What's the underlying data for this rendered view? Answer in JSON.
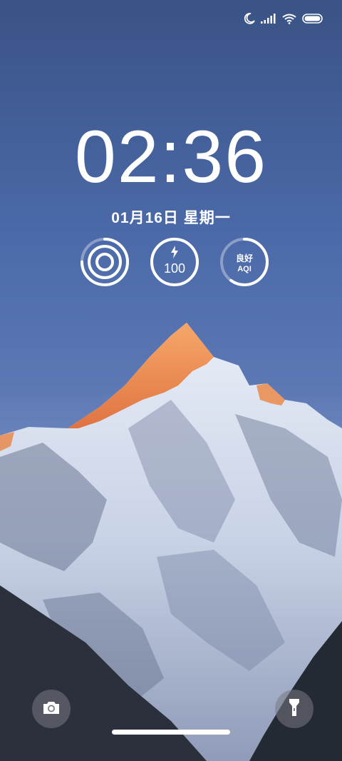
{
  "status_bar": {
    "icons": [
      "moon-icon",
      "signal-icon",
      "wifi-icon",
      "battery-icon"
    ]
  },
  "lockscreen": {
    "time": "02:36",
    "date": "01月16日 星期一"
  },
  "widgets": {
    "storage": {
      "icon": "storage-rings-icon",
      "fill_fraction": 0.75
    },
    "battery": {
      "icon": "bolt-icon",
      "value": "100",
      "fill_fraction": 1.0
    },
    "aqi": {
      "status": "良好",
      "label": "AQI",
      "fill_fraction": 0.6
    }
  },
  "shortcuts": {
    "camera_icon": "camera-icon",
    "flashlight_icon": "flashlight-icon"
  },
  "colors": {
    "sky_top": "#3a5386",
    "sky_mid": "#5b77b4",
    "snow": "#dfe6f2",
    "alpenglow": "#f28a45",
    "rock_dark": "#2a2f3c"
  }
}
